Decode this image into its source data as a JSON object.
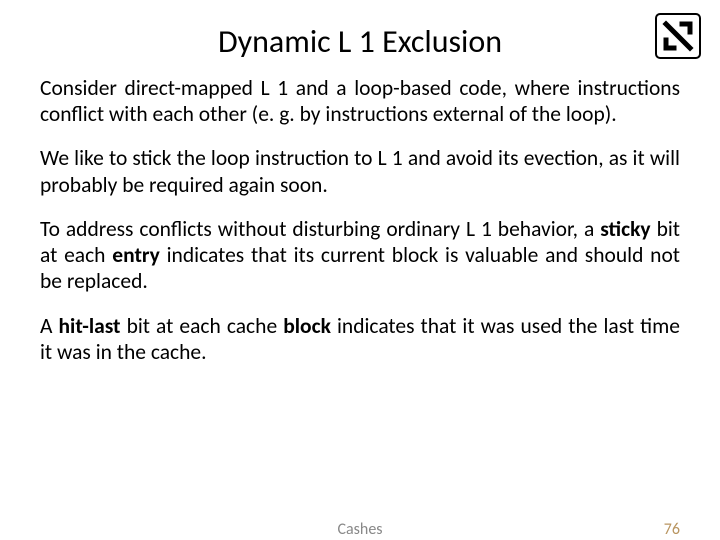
{
  "title": "Dynamic L 1 Exclusion",
  "para1": "Consider direct-mapped L 1 and a loop-based code, where instructions conflict with each other (e. g. by instructions external of the loop).",
  "para2": "We like to stick the loop instruction to L 1 and avoid its evection, as it will probably be required again soon.",
  "para3_a": "To address conflicts without disturbing ordinary L 1 behavior, a ",
  "para3_b": "sticky",
  "para3_c": " bit at each ",
  "para3_d": "entry",
  "para3_e": " indicates that its current block is valuable and should not be replaced.",
  "para4_a": "A ",
  "para4_b": "hit-last",
  "para4_c": " bit at each cache ",
  "para4_d": "block",
  "para4_e": " indicates that it was used the last time it was in the cache.",
  "footer_center": "Cashes",
  "footer_right": "76"
}
